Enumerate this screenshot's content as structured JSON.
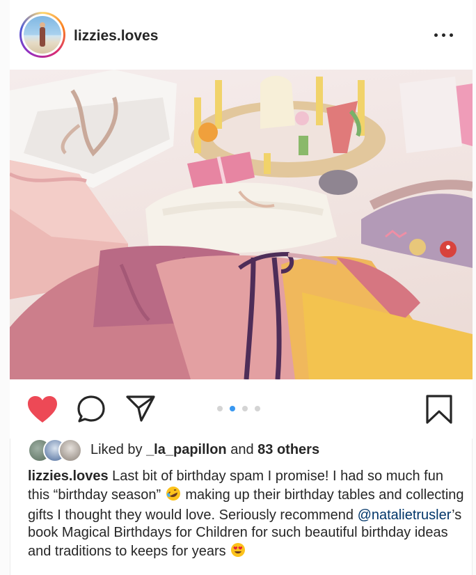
{
  "post": {
    "username": "lizzies.loves",
    "more_icon": "more-horizontal-icon",
    "carousel": {
      "count": 4,
      "active": 1
    }
  },
  "actions": {
    "like_icon": "heart-filled-icon",
    "comment_icon": "comment-icon",
    "share_icon": "share-icon",
    "save_icon": "bookmark-icon",
    "like_color": "#ed4956"
  },
  "likes": {
    "prefix": "Liked by ",
    "first_liker": "_la_papillon",
    "connector": " and ",
    "others": "83 others"
  },
  "caption": {
    "username": "lizzies.loves",
    "part1": " Last bit of birthday spam I promise! I had so much fun this “birthday season” ",
    "emoji1": "rolling-on-floor-laughing-emoji",
    "part2": " making up their birthday tables and collecting gifts I thought they would love. Seriously recommend ",
    "mention": "@natalietrusler",
    "part3": "’s book Magical Birthdays for Children for such beautiful birthday ideas and traditions to keeps for years ",
    "emoji2": "heart-eyes-emoji"
  },
  "colors": {
    "text": "#262626",
    "mention": "#003569",
    "carousel_active": "#3897f0",
    "carousel_inactive": "#d4d4d4"
  }
}
